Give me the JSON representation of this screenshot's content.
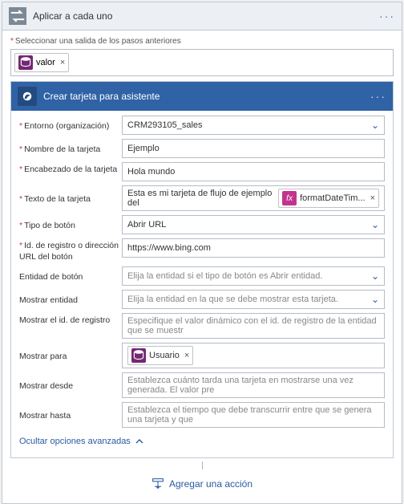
{
  "outer": {
    "title": "Aplicar a cada uno",
    "selectLabel": "Seleccionar una salida de los pasos anteriores",
    "token": "valor"
  },
  "inner": {
    "title": "Crear tarjeta para asistente"
  },
  "fields": {
    "env": {
      "label": "Entorno (organización)",
      "value": "CRM293105_sales"
    },
    "cardName": {
      "label": "Nombre de la tarjeta",
      "value": "Ejemplo"
    },
    "cardHeader": {
      "label": "Encabezado de la tarjeta",
      "value": "Hola mundo"
    },
    "cardText": {
      "label": "Texto de la tarjeta",
      "prefix": "Esta es mi tarjeta de flujo de ejemplo del",
      "token": "formatDateTim..."
    },
    "buttonType": {
      "label": "Tipo de botón",
      "value": "Abrir URL"
    },
    "recordUrl": {
      "label": "Id. de registro o dirección URL del botón",
      "value": "https://www.bing.com"
    },
    "buttonEntity": {
      "label": "Entidad de botón",
      "placeholder": "Elija la entidad si el tipo de botón es Abrir entidad."
    },
    "showEntity": {
      "label": "Mostrar entidad",
      "placeholder": "Elija la entidad en la que se debe mostrar esta tarjeta."
    },
    "showRecordId": {
      "label": "Mostrar el id. de registro",
      "placeholder": "Especifique el valor dinámico con el id. de registro de la entidad que se muestr"
    },
    "showFor": {
      "label": "Mostrar para",
      "token": "Usuario"
    },
    "showFrom": {
      "label": "Mostrar desde",
      "placeholder": "Establezca cuánto tarda una tarjeta en mostrarse una vez generada. El valor pre"
    },
    "showUntil": {
      "label": "Mostrar hasta",
      "placeholder": "Establezca el tiempo que debe transcurrir entre que se genera una tarjeta y que"
    }
  },
  "advToggle": "Ocultar opciones avanzadas",
  "addAction": "Agregar una acción"
}
